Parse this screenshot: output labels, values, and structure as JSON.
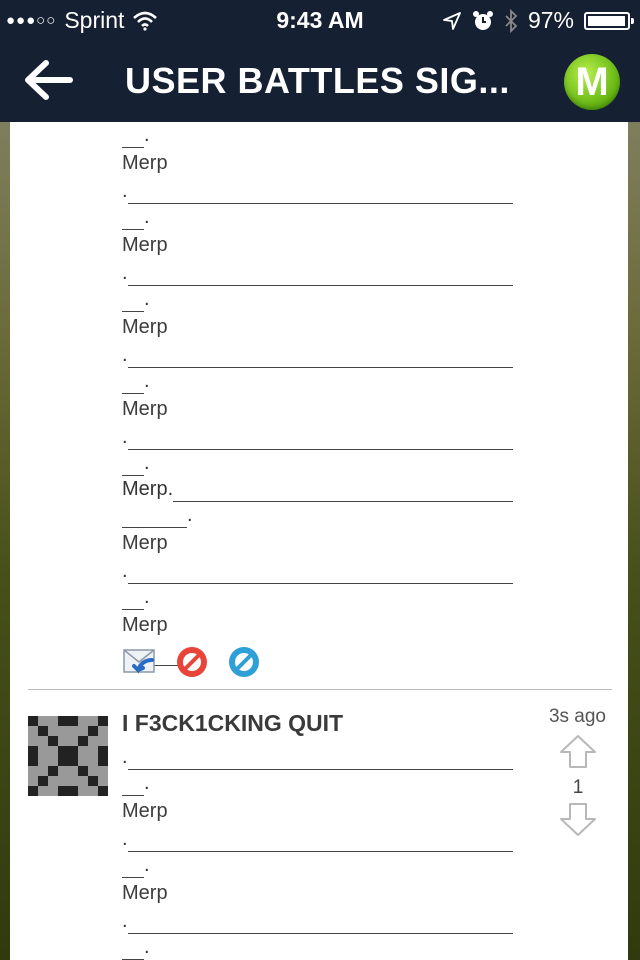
{
  "status_bar": {
    "signal": "●●●○○",
    "carrier": "Sprint",
    "time": "9:43 AM",
    "battery_percent": "97%",
    "icons": [
      "wifi-icon",
      "location-arrow-icon",
      "alarm-icon",
      "bluetooth-icon",
      "battery-icon"
    ]
  },
  "nav": {
    "title": "USER BATTLES SIG...",
    "logo_letter": "M",
    "logo_color": "#6ac21a",
    "bar_color": "#152032"
  },
  "first_post": {
    "merp": "Merp",
    "merp_period": "Merp.",
    "period": ".",
    "action_icons": [
      "reply-mail-icon",
      "block-red-icon",
      "block-blue-icon"
    ]
  },
  "second_post": {
    "title": "I F3CK1CKING QUIT",
    "timestamp": "3s ago",
    "vote_count": "1",
    "merp": "Merp",
    "period": "."
  }
}
